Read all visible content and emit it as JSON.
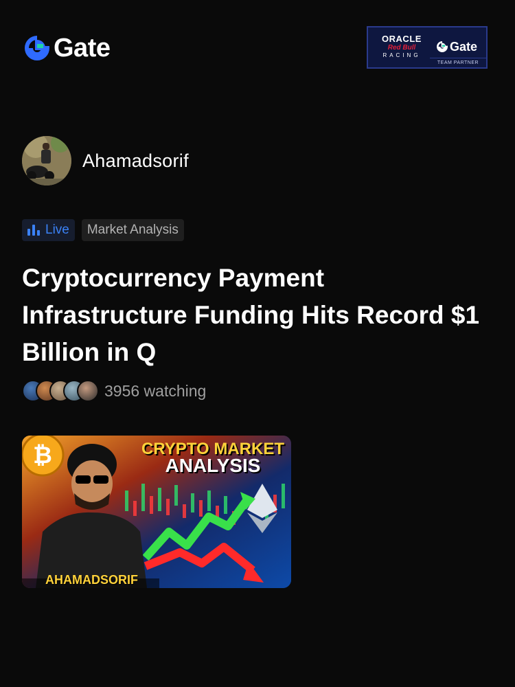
{
  "header": {
    "brand_name": "Gate",
    "partner": {
      "oracle": "ORACLE",
      "redbull": "Red Bull",
      "racing": "RACING",
      "gate": "Gate",
      "footer": "TEAM PARTNER"
    }
  },
  "post": {
    "author_name": "Ahamadsorif",
    "live_label": "Live",
    "category": "Market Analysis",
    "title": "Cryptocurrency Payment Infrastructure Funding Hits Record $1 Billion in Q",
    "watching": "3956 watching"
  },
  "thumbnail": {
    "title_line1": "CRYPTO MARKET",
    "title_line2": "ANALYSIS",
    "name": "AHAMADSORIF"
  },
  "colors": {
    "background": "#0a0a0a",
    "accent_blue": "#3b82f6",
    "muted_text": "#a0a0a0"
  }
}
